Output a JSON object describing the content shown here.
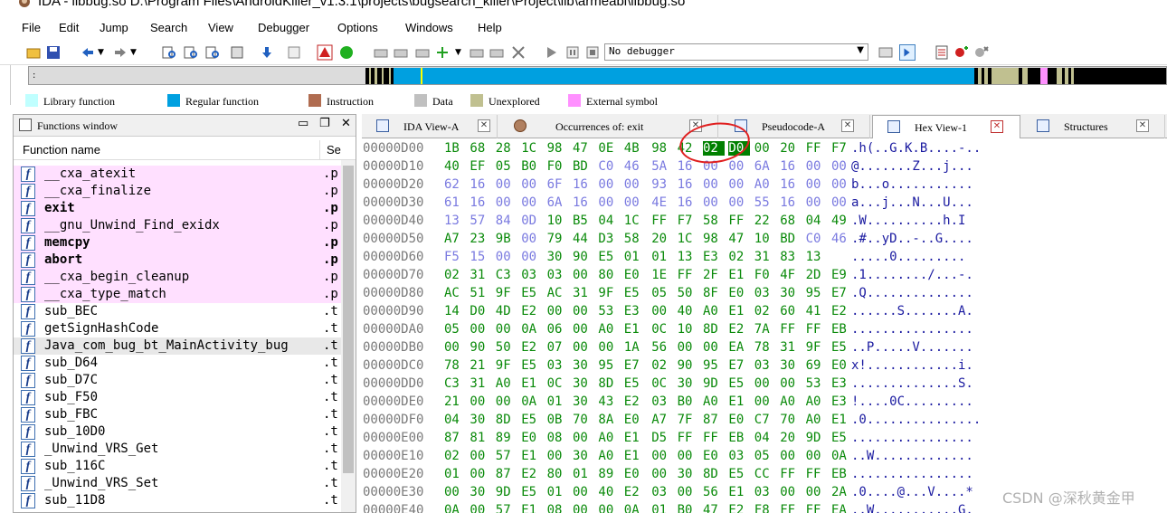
{
  "title": "IDA - libbug.so D:\\Program Files\\AndroidKiller_v1.3.1\\projects\\bugsearch_killer\\Project\\lib\\armeabi\\libbug.so",
  "menu": [
    "File",
    "Edit",
    "Jump",
    "Search",
    "View",
    "Debugger",
    "Options",
    "Windows",
    "Help"
  ],
  "debugger_select": "No debugger",
  "legend": [
    {
      "label": "Library function",
      "color": "#c0ffff"
    },
    {
      "label": "Regular function",
      "color": "#00a0e0"
    },
    {
      "label": "Instruction",
      "color": "#b06c50"
    },
    {
      "label": "Data",
      "color": "#c0c0c0"
    },
    {
      "label": "Unexplored",
      "color": "#c0c090"
    },
    {
      "label": "External symbol",
      "color": "#ff90ff"
    }
  ],
  "functions_window": {
    "title": "Functions window",
    "col_name": "Function name",
    "col_segment": "Se",
    "rows": [
      {
        "name": "__cxa_atexit",
        "seg": ".p",
        "type": "ext",
        "bold": false
      },
      {
        "name": "__cxa_finalize",
        "seg": ".p",
        "type": "ext",
        "bold": false
      },
      {
        "name": "exit",
        "seg": ".p",
        "type": "ext",
        "bold": true
      },
      {
        "name": "__gnu_Unwind_Find_exidx",
        "seg": ".p",
        "type": "ext",
        "bold": false
      },
      {
        "name": "memcpy",
        "seg": ".p",
        "type": "ext",
        "bold": true
      },
      {
        "name": "abort",
        "seg": ".p",
        "type": "ext",
        "bold": true
      },
      {
        "name": "__cxa_begin_cleanup",
        "seg": ".p",
        "type": "ext",
        "bold": false
      },
      {
        "name": "__cxa_type_match",
        "seg": ".p",
        "type": "ext",
        "bold": false
      },
      {
        "name": "sub_BEC",
        "seg": ".t",
        "type": "reg",
        "bold": false
      },
      {
        "name": "getSignHashCode",
        "seg": ".t",
        "type": "reg",
        "bold": false
      },
      {
        "name": "Java_com_bug_bt_MainActivity_bug",
        "seg": ".t",
        "type": "sel",
        "bold": false
      },
      {
        "name": "sub_D64",
        "seg": ".t",
        "type": "reg",
        "bold": false
      },
      {
        "name": "sub_D7C",
        "seg": ".t",
        "type": "reg",
        "bold": false
      },
      {
        "name": "sub_F50",
        "seg": ".t",
        "type": "reg",
        "bold": false
      },
      {
        "name": "sub_FBC",
        "seg": ".t",
        "type": "reg",
        "bold": false
      },
      {
        "name": "sub_10D0",
        "seg": ".t",
        "type": "reg",
        "bold": false
      },
      {
        "name": "_Unwind_VRS_Get",
        "seg": ".t",
        "type": "reg",
        "bold": false
      },
      {
        "name": "sub_116C",
        "seg": ".t",
        "type": "reg",
        "bold": false
      },
      {
        "name": "_Unwind_VRS_Set",
        "seg": ".t",
        "type": "reg",
        "bold": false
      },
      {
        "name": "sub_11D8",
        "seg": ".t",
        "type": "reg",
        "bold": false
      }
    ]
  },
  "tabs": [
    {
      "label": "IDA View-A",
      "active": false
    },
    {
      "label": "Occurrences of: exit",
      "active": false
    },
    {
      "label": "Pseudocode-A",
      "active": false
    },
    {
      "label": "Hex View-1",
      "active": true
    },
    {
      "label": "Structures",
      "active": false
    }
  ],
  "hex_rows": [
    {
      "addr": "00000D00",
      "bytes": [
        "1B",
        "68",
        "28",
        "1C",
        "98",
        "47",
        "0E",
        "4B",
        "98",
        "42",
        "02",
        "D0",
        "00",
        "20",
        "FF",
        "F7"
      ],
      "ascii": ".h(..G.K.B....-.."
    },
    {
      "addr": "00000D10",
      "bytes": [
        "40",
        "EF",
        "05",
        "B0",
        "F0",
        "BD",
        "C0",
        "46",
        "5A",
        "16",
        "00",
        "00",
        "6A",
        "16",
        "00",
        "00"
      ],
      "ascii": "@.......Z...j..."
    },
    {
      "addr": "00000D20",
      "bytes": [
        "62",
        "16",
        "00",
        "00",
        "6F",
        "16",
        "00",
        "00",
        "93",
        "16",
        "00",
        "00",
        "A0",
        "16",
        "00",
        "00"
      ],
      "ascii": "b...o..........."
    },
    {
      "addr": "00000D30",
      "bytes": [
        "61",
        "16",
        "00",
        "00",
        "6A",
        "16",
        "00",
        "00",
        "4E",
        "16",
        "00",
        "00",
        "55",
        "16",
        "00",
        "00"
      ],
      "ascii": "a...j...N...U..."
    },
    {
      "addr": "00000D40",
      "bytes": [
        "13",
        "57",
        "84",
        "0D",
        "10",
        "B5",
        "04",
        "1C",
        "FF",
        "F7",
        "58",
        "FF",
        "22",
        "68",
        "04",
        "49"
      ],
      "ascii": ".W..........h.I"
    },
    {
      "addr": "00000D50",
      "bytes": [
        "A7",
        "23",
        "9B",
        "00",
        "79",
        "44",
        "D3",
        "58",
        "20",
        "1C",
        "98",
        "47",
        "10",
        "BD",
        "C0",
        "46"
      ],
      "ascii": ".#..yD..-..G...."
    },
    {
      "addr": "00000D60",
      "bytes": [
        "F5",
        "15",
        "00",
        "00",
        "30",
        "90",
        "E5",
        "01",
        "01",
        "13",
        "E3",
        "02",
        "31",
        "83",
        "13"
      ],
      "ascii": ".....0........."
    },
    {
      "addr": "00000D70",
      "bytes": [
        "02",
        "31",
        "C3",
        "03",
        "03",
        "00",
        "80",
        "E0",
        "1E",
        "FF",
        "2F",
        "E1",
        "F0",
        "4F",
        "2D",
        "E9"
      ],
      "ascii": ".1......../...-."
    },
    {
      "addr": "00000D80",
      "bytes": [
        "AC",
        "51",
        "9F",
        "E5",
        "AC",
        "31",
        "9F",
        "E5",
        "05",
        "50",
        "8F",
        "E0",
        "03",
        "30",
        "95",
        "E7"
      ],
      "ascii": ".Q.............."
    },
    {
      "addr": "00000D90",
      "bytes": [
        "14",
        "D0",
        "4D",
        "E2",
        "00",
        "00",
        "53",
        "E3",
        "00",
        "40",
        "A0",
        "E1",
        "02",
        "60",
        "41",
        "E2"
      ],
      "ascii": "......S.......A."
    },
    {
      "addr": "00000DA0",
      "bytes": [
        "05",
        "00",
        "00",
        "0A",
        "06",
        "00",
        "A0",
        "E1",
        "0C",
        "10",
        "8D",
        "E2",
        "7A",
        "FF",
        "FF",
        "EB"
      ],
      "ascii": "................"
    },
    {
      "addr": "00000DB0",
      "bytes": [
        "00",
        "90",
        "50",
        "E2",
        "07",
        "00",
        "00",
        "1A",
        "56",
        "00",
        "00",
        "EA",
        "78",
        "31",
        "9F",
        "E5"
      ],
      "ascii": "..P.....V......."
    },
    {
      "addr": "00000DC0",
      "bytes": [
        "78",
        "21",
        "9F",
        "E5",
        "03",
        "30",
        "95",
        "E7",
        "02",
        "90",
        "95",
        "E7",
        "03",
        "30",
        "69",
        "E0"
      ],
      "ascii": "x!............i."
    },
    {
      "addr": "00000DD0",
      "bytes": [
        "C3",
        "31",
        "A0",
        "E1",
        "0C",
        "30",
        "8D",
        "E5",
        "0C",
        "30",
        "9D",
        "E5",
        "00",
        "00",
        "53",
        "E3"
      ],
      "ascii": "..............S."
    },
    {
      "addr": "00000DE0",
      "bytes": [
        "21",
        "00",
        "00",
        "0A",
        "01",
        "30",
        "43",
        "E2",
        "03",
        "B0",
        "A0",
        "E1",
        "00",
        "A0",
        "A0",
        "E3"
      ],
      "ascii": "!....0C........."
    },
    {
      "addr": "00000DF0",
      "bytes": [
        "04",
        "30",
        "8D",
        "E5",
        "0B",
        "70",
        "8A",
        "E0",
        "A7",
        "7F",
        "87",
        "E0",
        "C7",
        "70",
        "A0",
        "E1"
      ],
      "ascii": ".0..............."
    },
    {
      "addr": "00000E00",
      "bytes": [
        "87",
        "81",
        "89",
        "E0",
        "08",
        "00",
        "A0",
        "E1",
        "D5",
        "FF",
        "FF",
        "EB",
        "04",
        "20",
        "9D",
        "E5"
      ],
      "ascii": "................"
    },
    {
      "addr": "00000E10",
      "bytes": [
        "02",
        "00",
        "57",
        "E1",
        "00",
        "30",
        "A0",
        "E1",
        "00",
        "00",
        "E0",
        "03",
        "05",
        "00",
        "00",
        "0A"
      ],
      "ascii": "..W............."
    },
    {
      "addr": "00000E20",
      "bytes": [
        "01",
        "00",
        "87",
        "E2",
        "80",
        "01",
        "89",
        "E0",
        "00",
        "30",
        "8D",
        "E5",
        "CC",
        "FF",
        "FF",
        "EB"
      ],
      "ascii": "................"
    },
    {
      "addr": "00000E30",
      "bytes": [
        "00",
        "30",
        "9D",
        "E5",
        "01",
        "00",
        "40",
        "E2",
        "03",
        "00",
        "56",
        "E1",
        "03",
        "00",
        "00",
        "2A"
      ],
      "ascii": ".0....@...V....*"
    },
    {
      "addr": "00000E40",
      "bytes": [
        "0A",
        "00",
        "57",
        "E1",
        "08",
        "00",
        "00",
        "0A",
        "01",
        "B0",
        "47",
        "E2",
        "F8",
        "FF",
        "FF",
        "EA"
      ],
      "ascii": "..W...........G."
    }
  ],
  "selected_bytes_row": 0,
  "selected_bytes": [
    10,
    11
  ],
  "watermark": "CSDN @深秋黄金甲"
}
